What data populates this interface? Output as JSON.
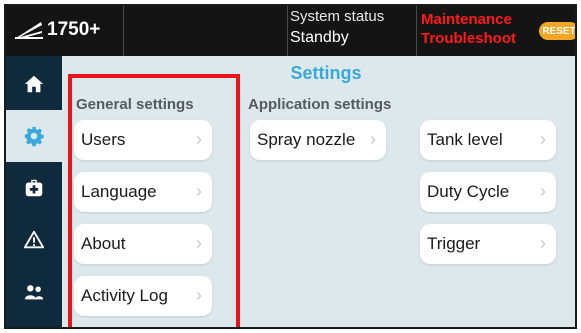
{
  "header": {
    "model": "1750+",
    "status_label": "System status",
    "status_value": "Standby",
    "alerts": [
      "Maintenance",
      "Troubleshoot"
    ],
    "reset_label": "RESET"
  },
  "page": {
    "title": "Settings"
  },
  "general": {
    "heading": "General settings",
    "items": [
      "Users",
      "Language",
      "About",
      "Activity Log"
    ]
  },
  "application": {
    "heading": "Application settings",
    "items": [
      "Spray nozzle",
      "Tank level",
      "Duty Cycle",
      "Trigger"
    ]
  },
  "nav": {
    "items": [
      "home-icon",
      "gear-icon",
      "medkit-icon",
      "warning-icon",
      "users-icon"
    ],
    "active": "gear-icon"
  },
  "colors": {
    "accent": "#3aa8d8",
    "alert": "#ff1a1a",
    "reset": "#f5a623",
    "nav_bg": "#0f2a3d",
    "highlight": "#e8141c"
  },
  "chevron": "›"
}
